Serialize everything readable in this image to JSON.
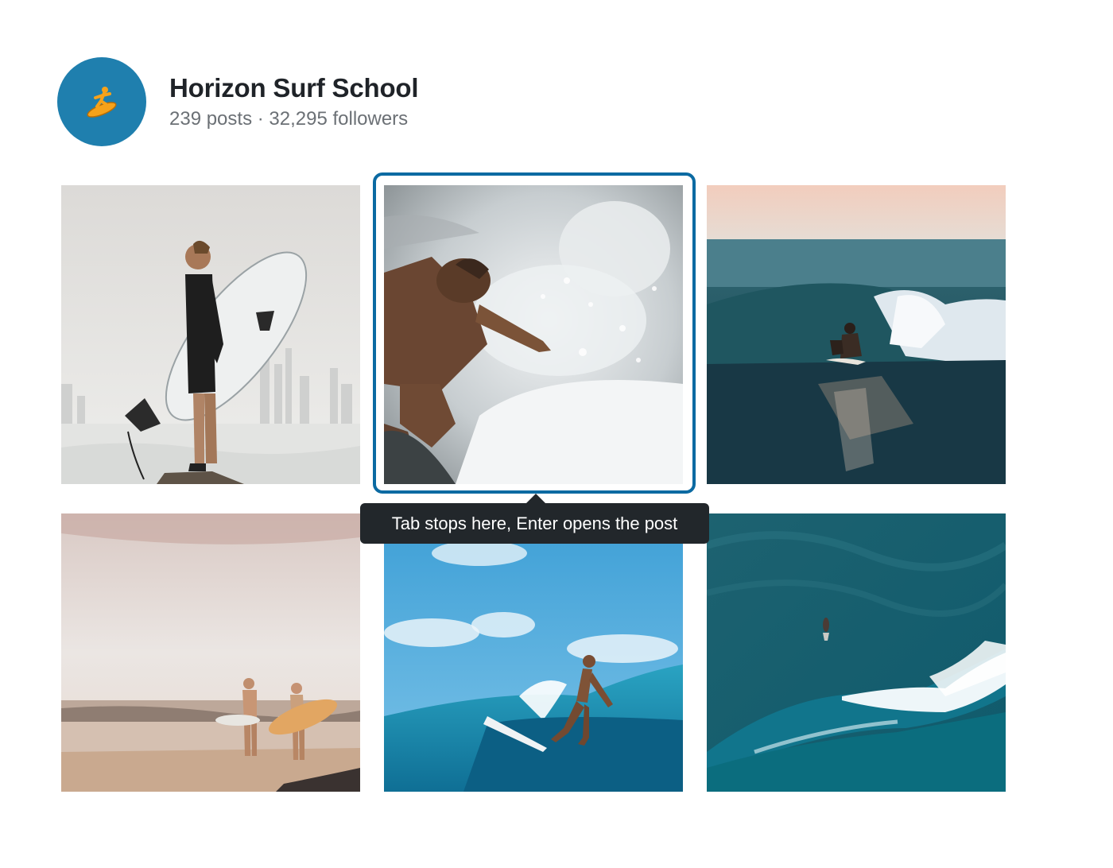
{
  "profile": {
    "name": "Horizon Surf School",
    "stats": "239 posts · 32,295 followers",
    "avatar_icon": "surfer-icon",
    "avatar_color": "#1f7fae"
  },
  "grid": {
    "posts": [
      {
        "subject": "surfer-holding-board-photo"
      },
      {
        "subject": "surfer-in-spray-photo",
        "focused": true
      },
      {
        "subject": "surfer-in-barrel-wave-photo"
      },
      {
        "subject": "two-surfers-walking-beach-photo"
      },
      {
        "subject": "surfer-riding-wave-photo"
      },
      {
        "subject": "aerial-wave-photo"
      }
    ],
    "focus_color": "#0b6aa2"
  },
  "tooltip": {
    "text": "Tab stops here, Enter opens the post"
  }
}
